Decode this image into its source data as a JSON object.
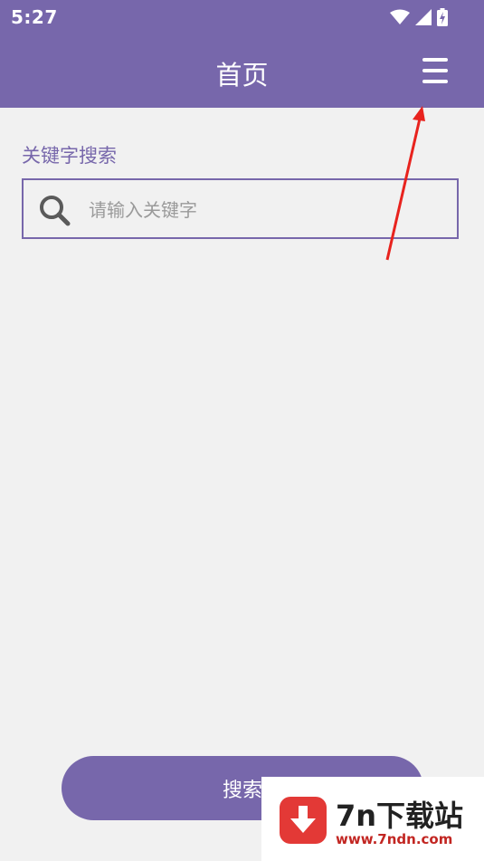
{
  "status_bar": {
    "time": "5:27"
  },
  "app_bar": {
    "title": "首页",
    "menu_icon": "hamburger-menu-icon"
  },
  "search": {
    "label": "关键字搜索",
    "placeholder": "请输入关键字",
    "value": "",
    "icon": "search-icon"
  },
  "search_button": {
    "label": "搜索"
  },
  "watermark": {
    "title": "7n下载站",
    "url": "www.7ndn.com"
  },
  "colors": {
    "primary": "#7767ab",
    "background": "#f1f1f1",
    "annotation": "#e8231e"
  }
}
